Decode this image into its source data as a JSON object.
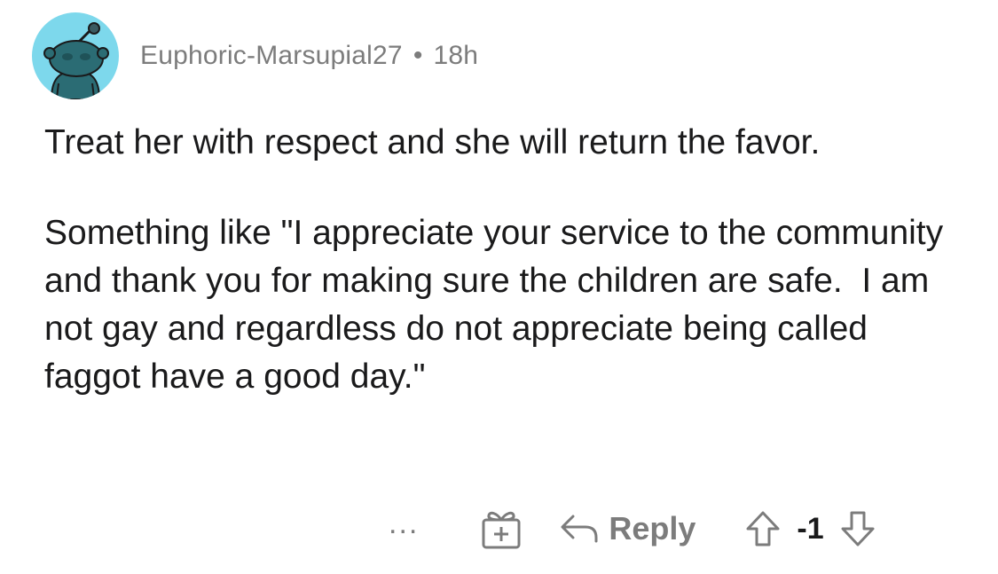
{
  "comment": {
    "author": "Euphoric-Marsupial27",
    "separator": "•",
    "age": "18h",
    "paragraphs": [
      "Treat her with respect and she will return the favor.",
      "Something like \"I appreciate your service to the community and thank you for making sure the children are safe.  I am not gay and regardless do not appreciate being called faggot have a good day.\""
    ]
  },
  "actions": {
    "more_label": "...",
    "reply_label": "Reply",
    "score": "-1"
  },
  "icons": {
    "avatar": "snoo-avatar-icon",
    "award": "gift-award-icon",
    "reply": "reply-arrow-icon",
    "upvote": "upvote-arrow-icon",
    "downvote": "downvote-arrow-icon"
  },
  "colors": {
    "avatar_bg": "#7dd8ec",
    "meta_text": "#7c7c7c",
    "body_text": "#1a1a1b"
  }
}
